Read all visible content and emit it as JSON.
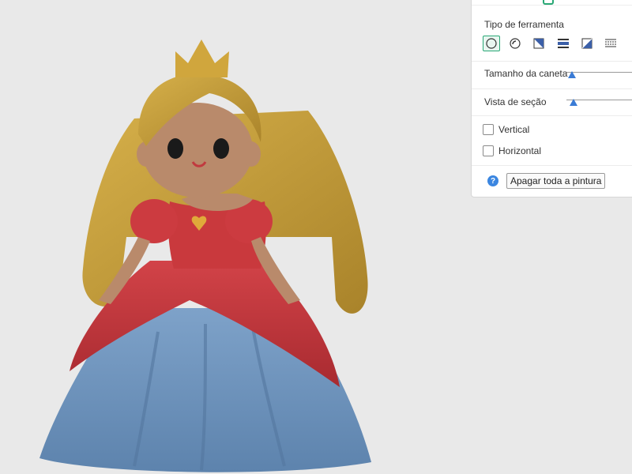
{
  "panel": {
    "tool_type_label": "Tipo de ferramenta",
    "tools": [
      {
        "name": "circle-brush",
        "active": true
      },
      {
        "name": "sphere-brush",
        "active": false
      },
      {
        "name": "triangle-fill",
        "active": false
      },
      {
        "name": "horizontal-fill",
        "active": false
      },
      {
        "name": "gap-fill",
        "active": false
      },
      {
        "name": "height-range",
        "active": false
      }
    ],
    "pen_size_label": "Tamanho da caneta",
    "pen_size_value": 0.02,
    "section_view_label": "Vista de seção",
    "section_view_value": 0.05,
    "vertical_label": "Vertical",
    "vertical_checked": false,
    "horizontal_label": "Horizontal",
    "horizontal_checked": false,
    "help_glyph": "?",
    "clear_button_label": "Apagar toda a pintura"
  },
  "colors": {
    "accent": "#2aa876",
    "thumb": "#3a7bd5",
    "hair": "#c9a23a",
    "dress_top": "#c9393d",
    "dress_skirt": "#6d93bd",
    "skin": "#b98a6b"
  }
}
